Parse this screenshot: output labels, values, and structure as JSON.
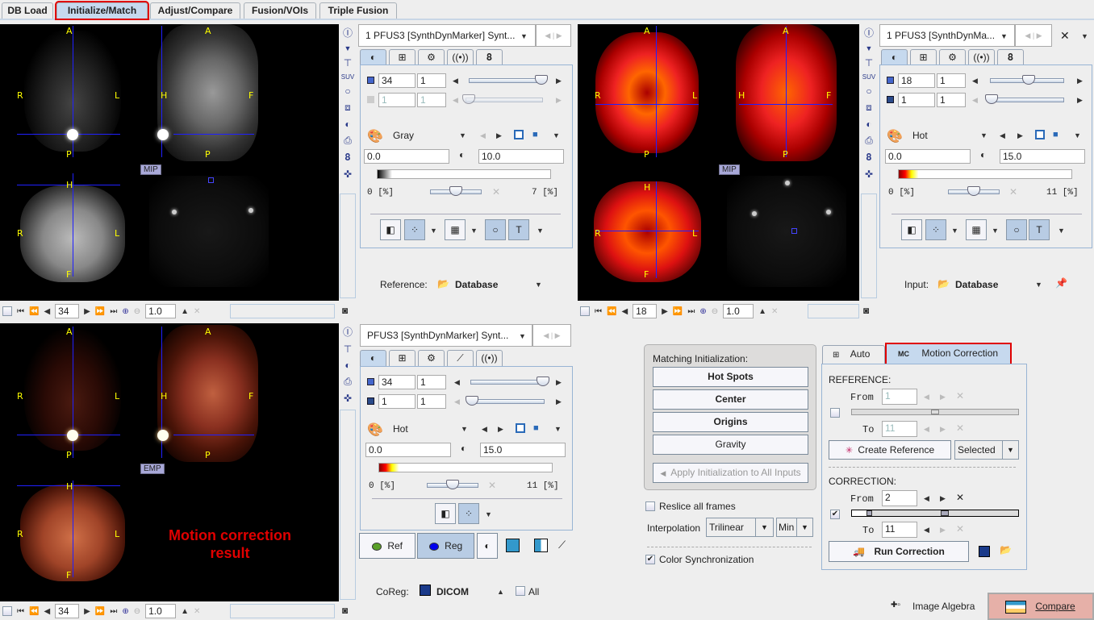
{
  "main_tabs": [
    {
      "label": "DB Load",
      "active": false
    },
    {
      "label": "Initialize/Match",
      "active": true
    },
    {
      "label": "Adjust/Compare",
      "active": false
    },
    {
      "label": "Fusion/VOIs",
      "active": false
    },
    {
      "label": "Triple Fusion",
      "active": false
    }
  ],
  "orient": {
    "A": "A",
    "P": "P",
    "R": "R",
    "L": "L",
    "H": "H",
    "F": "F"
  },
  "ref_viewer": {
    "mip_tag": "MIP",
    "nav": {
      "slice": "34",
      "zoom": "1.0"
    }
  },
  "in_viewer": {
    "mip_tag": "MIP",
    "nav": {
      "slice": "18",
      "zoom": "1.0"
    }
  },
  "res_viewer": {
    "emp_tag": "EMP",
    "annotation": "Motion correction result",
    "nav": {
      "slice": "34",
      "zoom": "1.0"
    }
  },
  "ref_panel": {
    "series": "1 PFUS3 [SynthDynMarker] Synt...",
    "slice": "34",
    "slice_step": "1",
    "frame": "1",
    "frame_step": "1",
    "colormap": "Gray",
    "min": "0.0",
    "max": "10.0",
    "lower_pct": "0  [%]",
    "upper_pct": "7  [%]",
    "source_label": "Reference:",
    "source_value": "Database",
    "slice_slider": 0.97,
    "frame_slider": 0.0
  },
  "in_panel": {
    "series": "1 PFUS3 [SynthDynMa...",
    "slice": "18",
    "slice_step": "1",
    "frame": "1",
    "frame_step": "1",
    "colormap": "Hot",
    "min": "0.0",
    "max": "15.0",
    "lower_pct": "0  [%]",
    "upper_pct": "11  [%]",
    "source_label": "Input:",
    "source_value": "Database",
    "slice_slider": 0.53,
    "frame_slider": 0.0
  },
  "res_panel": {
    "series": "PFUS3 [SynthDynMarker] Synt...",
    "slice": "34",
    "slice_step": "1",
    "frame": "1",
    "frame_step": "1",
    "colormap": "Hot",
    "min": "0.0",
    "max": "15.0",
    "lower_pct": "0  [%]",
    "upper_pct": "11  [%]",
    "ref_btn": "Ref",
    "reg_btn": "Reg",
    "coreg_label": "CoReg:",
    "coreg_value": "DICOM",
    "all_label": "All",
    "slice_slider": 0.97,
    "frame_slider": 0.0
  },
  "matching": {
    "title": "Matching Initialization:",
    "buttons": [
      "Hot Spots",
      "Center",
      "Origins",
      "Gravity"
    ],
    "apply_all": "Apply Initialization to All Inputs",
    "reslice_label": "Reslice all frames",
    "reslice_checked": false,
    "interp_label": "Interpolation",
    "interp_value": "Trilinear",
    "interp_mode": "Min",
    "color_sync_label": "Color Synchronization",
    "color_sync_checked": true
  },
  "motion": {
    "tabs": [
      {
        "label": "Auto",
        "active": false
      },
      {
        "label": "Motion Correction",
        "active": true
      }
    ],
    "reference_title": "REFERENCE:",
    "ref_from_label": "From",
    "ref_from": "1",
    "ref_to_label": "To",
    "ref_to": "11",
    "create_ref_btn": "Create Reference",
    "ref_mode": "Selected",
    "correction_title": "CORRECTION:",
    "corr_from_label": "From",
    "corr_from": "2",
    "corr_to_label": "To",
    "corr_to": "11",
    "run_btn": "Run Correction"
  },
  "footer": {
    "image_algebra": "Image Algebra",
    "compare": "Compare"
  },
  "colors": {
    "accent_red": "#e00000",
    "selected_blue": "#c6d9ee",
    "compare_bg": "#e6b0a8"
  }
}
